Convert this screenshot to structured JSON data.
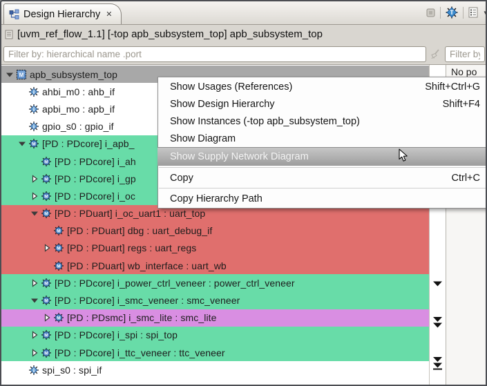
{
  "colors": {
    "green": "#68dca8",
    "red": "#e06f6d",
    "purple": "#d98ee2",
    "selected_row": "#a8a8a8",
    "menu_highlight_top": "#c6c6c6",
    "menu_highlight_bottom": "#9f9f9f"
  },
  "tab": {
    "title": "Design Hierarchy"
  },
  "icons": {
    "tab": "hierarchy-tree",
    "tab_close": "close",
    "toolbar": [
      "minimize-square",
      "gear-t",
      "outline-list",
      "chevron-down"
    ],
    "info": "document",
    "filter_clear": "brush",
    "tree_module": "gear-module-m",
    "tree_interface": "gear-interface-i",
    "tree_root": "chip-module-m",
    "gutter_markers": [
      "scroll-down",
      "scroll-down-double",
      "scroll-end"
    ],
    "cursor": "arrow-pointer"
  },
  "info_bar": {
    "text": "[uvm_ref_flow_1.1] [-top apb_subsystem_top] apb_subsystem_top"
  },
  "filter_bar": {
    "hierarchy_placeholder": "Filter by: hierarchical name .port",
    "right_placeholder": "Filter by"
  },
  "right_panel": {
    "message": "No po"
  },
  "tree": {
    "rows": [
      {
        "level": 0,
        "expander": "expanded",
        "icon": "root",
        "label": "apb_subsystem_top",
        "bg": "selected"
      },
      {
        "level": 1,
        "expander": "none",
        "icon": "interface",
        "label": "ahbi_m0 : ahb_if",
        "bg": "none"
      },
      {
        "level": 1,
        "expander": "none",
        "icon": "interface",
        "label": "apbi_mo : apb_if",
        "bg": "none"
      },
      {
        "level": 1,
        "expander": "none",
        "icon": "interface",
        "label": "gpio_s0 : gpio_if",
        "bg": "none"
      },
      {
        "level": 1,
        "expander": "expanded",
        "icon": "module",
        "label": "[PD : PDcore] i_apb_",
        "bg": "green"
      },
      {
        "level": 2,
        "expander": "none",
        "icon": "module",
        "label": "[PD : PDcore] i_ah",
        "bg": "green"
      },
      {
        "level": 2,
        "expander": "collapsed",
        "icon": "module",
        "label": "[PD : PDcore] i_gp",
        "bg": "green"
      },
      {
        "level": 2,
        "expander": "collapsed",
        "icon": "module",
        "label": "[PD : PDcore] i_oc",
        "bg": "green"
      },
      {
        "level": 2,
        "expander": "expanded",
        "icon": "module",
        "label": "[PD : PDuart] i_oc_uart1 : uart_top",
        "bg": "red"
      },
      {
        "level": 3,
        "expander": "none",
        "icon": "module",
        "label": "[PD : PDuart] dbg : uart_debug_if",
        "bg": "red"
      },
      {
        "level": 3,
        "expander": "collapsed",
        "icon": "module",
        "label": "[PD : PDuart] regs : uart_regs",
        "bg": "red"
      },
      {
        "level": 3,
        "expander": "none",
        "icon": "module",
        "label": "[PD : PDuart] wb_interface : uart_wb",
        "bg": "red"
      },
      {
        "level": 2,
        "expander": "collapsed",
        "icon": "module",
        "label": "[PD : PDcore] i_power_ctrl_veneer : power_ctrl_veneer",
        "bg": "green"
      },
      {
        "level": 2,
        "expander": "expanded",
        "icon": "module",
        "label": "[PD : PDcore] i_smc_veneer : smc_veneer",
        "bg": "green"
      },
      {
        "level": 3,
        "expander": "collapsed",
        "icon": "module",
        "label": "[PD : PDsmc] i_smc_lite : smc_lite",
        "bg": "purple"
      },
      {
        "level": 2,
        "expander": "collapsed",
        "icon": "module",
        "label": "[PD : PDcore] i_spi : spi_top",
        "bg": "green"
      },
      {
        "level": 2,
        "expander": "collapsed",
        "icon": "module",
        "label": "[PD : PDcore] i_ttc_veneer : ttc_veneer",
        "bg": "green"
      },
      {
        "level": 1,
        "expander": "none",
        "icon": "interface",
        "label": "spi_s0 : spi_if",
        "bg": "none"
      }
    ]
  },
  "context_menu": {
    "items": [
      {
        "type": "item",
        "label": "Show Usages (References)",
        "shortcut": "Shift+Ctrl+G",
        "highlighted": false
      },
      {
        "type": "item",
        "label": "Show Design Hierarchy",
        "shortcut": "Shift+F4",
        "highlighted": false
      },
      {
        "type": "item",
        "label": "Show Instances (-top apb_subsystem_top)",
        "shortcut": "",
        "highlighted": false
      },
      {
        "type": "item",
        "label": "Show Diagram",
        "shortcut": "",
        "highlighted": false
      },
      {
        "type": "item",
        "label": "Show Supply Network Diagram",
        "shortcut": "",
        "highlighted": true
      },
      {
        "type": "separator"
      },
      {
        "type": "item",
        "label": "Copy",
        "shortcut": "Ctrl+C",
        "highlighted": false
      },
      {
        "type": "separator"
      },
      {
        "type": "item",
        "label": "Copy Hierarchy Path",
        "shortcut": "",
        "highlighted": false
      }
    ]
  }
}
